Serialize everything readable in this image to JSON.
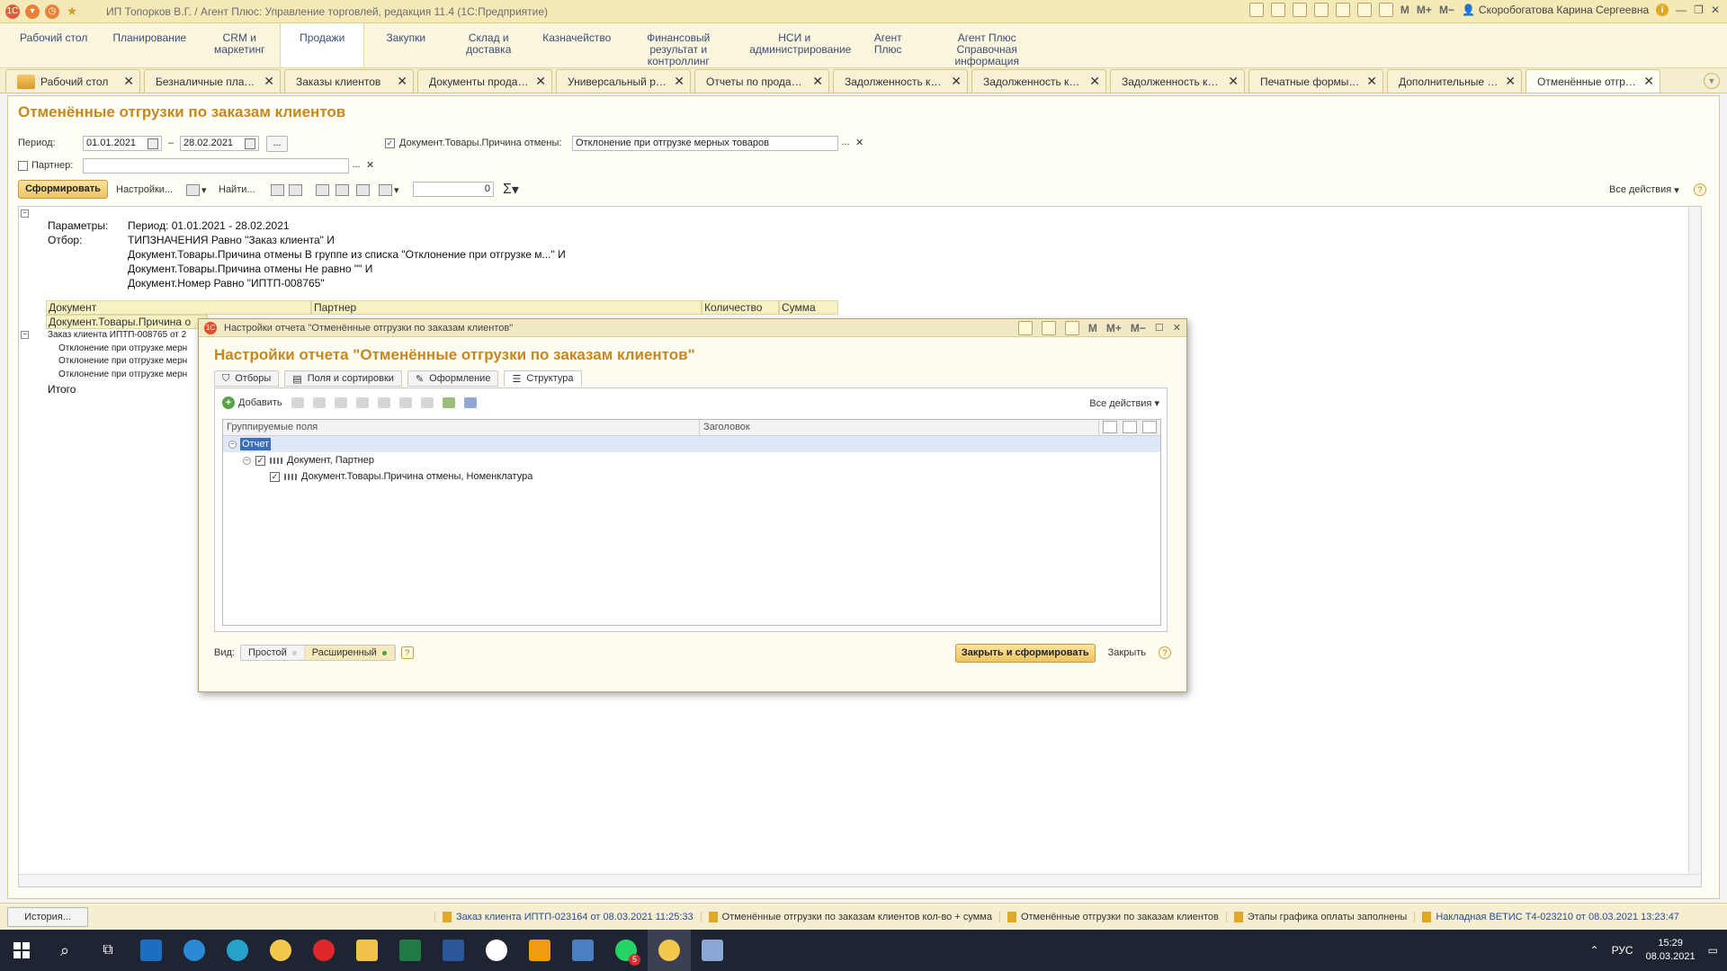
{
  "window": {
    "title": "ИП Топорков В.Г. / Агент Плюс: Управление торговлей, редакция 11.4  (1С:Предприятие)",
    "user": "Скоробогатова Карина Сергеевна",
    "m": "M",
    "mplus": "M+",
    "mminus": "M−"
  },
  "sections": [
    {
      "label": "Рабочий стол"
    },
    {
      "label": "Планирование"
    },
    {
      "label": "CRM и маркетинг"
    },
    {
      "label": "Продажи"
    },
    {
      "label": "Закупки"
    },
    {
      "label": "Склад и доставка"
    },
    {
      "label": "Казначейство"
    },
    {
      "label": "Финансовый результат и контроллинг"
    },
    {
      "label": "НСИ и администрирование"
    },
    {
      "label": "Агент Плюс"
    },
    {
      "label": "Агент Плюс Справочная информация"
    }
  ],
  "tabs": [
    {
      "label": "Рабочий стол"
    },
    {
      "label": "Безналичные платежи"
    },
    {
      "label": "Заказы клиентов"
    },
    {
      "label": "Документы продаж..."
    },
    {
      "label": "Универсальный ред..."
    },
    {
      "label": "Отчеты по продажам"
    },
    {
      "label": "Задолженность кли..."
    },
    {
      "label": "Задолженность кли..."
    },
    {
      "label": "Задолженность кли..."
    },
    {
      "label": "Печатные формы, от..."
    },
    {
      "label": "Дополнительные отч..."
    },
    {
      "label": "Отменённые отгруз..."
    }
  ],
  "form": {
    "title": "Отменённые отгрузки по заказам клиентов",
    "period_label": "Период:",
    "date_from": "01.01.2021",
    "date_to": "28.02.2021",
    "dash": "–",
    "dots": "...",
    "reason_label": "Документ.Товары.Причина отмены:",
    "reason_value": "Отклонение при отгрузке мерных товаров",
    "partner_label": "Партнер:",
    "partner_value": "",
    "btn_form": "Сформировать",
    "btn_settings": "Настройки...",
    "btn_find": "Найти...",
    "num_value": "0",
    "sigma": "Σ",
    "all_actions": "Все действия",
    "help": "?"
  },
  "report": {
    "params_label": "Параметры:",
    "params_value": "Период: 01.01.2021 - 28.02.2021",
    "filter_label": "Отбор:",
    "filter_lines": [
      "ТИПЗНАЧЕНИЯ Равно \"Заказ клиента\" И",
      "Документ.Товары.Причина отмены В группе из списка \"Отклонение при отгрузке м...\" И",
      "Документ.Товары.Причина отмены Не равно \"\" И",
      "Документ.Номер Равно \"ИПТП-008765\""
    ],
    "col_doc": "Документ",
    "col_partner": "Партнер",
    "col_qty": "Количество",
    "col_sum": "Сумма",
    "col_reason": "Документ.Товары.Причина о",
    "row_order": "Заказ клиента ИПТП-008765 от 2",
    "row_reason": "Отклонение при отгрузке мерн",
    "total": "Итого"
  },
  "modal": {
    "window_title": "Настройки отчета \"Отменённые отгрузки по заказам клиентов\"",
    "title": "Настройки отчета \"Отменённые отгрузки по заказам клиентов\"",
    "tabs": [
      {
        "label": "Отборы"
      },
      {
        "label": "Поля и сортировки"
      },
      {
        "label": "Оформление"
      },
      {
        "label": "Структура"
      }
    ],
    "add": "Добавить",
    "all_actions": "Все действия",
    "col_fields": "Группируемые поля",
    "col_header": "Заголовок",
    "tree": {
      "root": "Отчет",
      "child": "Документ, Партнер",
      "grandchild": "Документ.Товары.Причина отмены, Номенклатура"
    },
    "vid_label": "Вид:",
    "vid_simple": "Простой",
    "vid_extended": "Расширенный",
    "close_and_form": "Закрыть и сформировать",
    "close": "Закрыть",
    "help": "?"
  },
  "status": {
    "history": "История...",
    "notifications": [
      {
        "text": "Заказ клиента ИПТП-023164 от 08.03.2021 11:25:33",
        "link": true
      },
      {
        "text": "Отменённые отгрузки по заказам клиентов  кол-во + сумма",
        "link": false
      },
      {
        "text": "Отменённые отгрузки по заказам клиентов",
        "link": false
      },
      {
        "text": "Этапы графика оплаты заполнены",
        "link": false
      },
      {
        "text": "Накладная ВЕТИС Т4-023210 от 08.03.2021 13:23:47",
        "link": true
      }
    ]
  },
  "taskbar": {
    "lang": "РУС",
    "time": "15:29",
    "date": "08.03.2021",
    "badge": "5"
  }
}
